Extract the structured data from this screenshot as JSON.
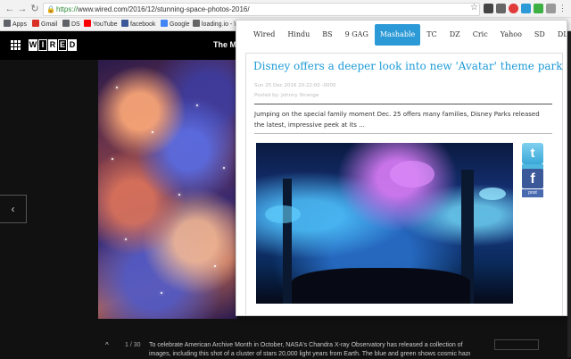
{
  "browser": {
    "url_scheme": "https://",
    "url_rest": "www.wired.com/2016/12/stunning-space-photos-2016/",
    "bookmarks": [
      {
        "label": "Apps",
        "color": "#5f6368",
        "icon": "apps-grid-icon"
      },
      {
        "label": "Gmail",
        "color": "#d93025",
        "icon": "gmail-icon"
      },
      {
        "label": "DS",
        "color": "#5f6368",
        "icon": "ds-icon"
      },
      {
        "label": "YouTube",
        "color": "#ff0000",
        "icon": "youtube-icon"
      },
      {
        "label": "facebook",
        "color": "#3b5998",
        "icon": "facebook-icon"
      },
      {
        "label": "Google",
        "color": "#4285f4",
        "icon": "google-icon"
      },
      {
        "label": "loading.io - \\",
        "color": "#666666",
        "icon": "loading-io-icon"
      }
    ]
  },
  "wired": {
    "logo_letters": [
      "W",
      "I",
      "R",
      "E",
      "D"
    ],
    "headline": "The M",
    "caption_count": "1 / 30",
    "caption_line1": "To celebrate American Archive Month in October, NASA's Chandra X-ray Observatory has released a collection of",
    "caption_line2": "images, including this shot of a cluster of stars 20,000 light years from Earth. The blue and green shows cosmic haze"
  },
  "popup": {
    "tabs": [
      "Wired",
      "Hindu",
      "BS",
      "9 GAG",
      "Mashable",
      "TC",
      "DZ",
      "Cric",
      "Yahoo",
      "SD",
      "DLM"
    ],
    "active_tab": "Mashable",
    "accent_color": "#2c9ad6",
    "article": {
      "title": "Disney offers a deeper look into new 'Avatar' theme park",
      "date": "Sun 25 Dec 2016 20:22:00 -0000",
      "author": "Posted by: Johnny Strange",
      "summary": "Jumping on the special family moment Dec. 25 offers many families, Disney Parks released the latest, impressive peek at its ..."
    },
    "share": {
      "twitter_glyph": "t",
      "facebook_glyph": "f",
      "facebook_label": "post"
    }
  }
}
